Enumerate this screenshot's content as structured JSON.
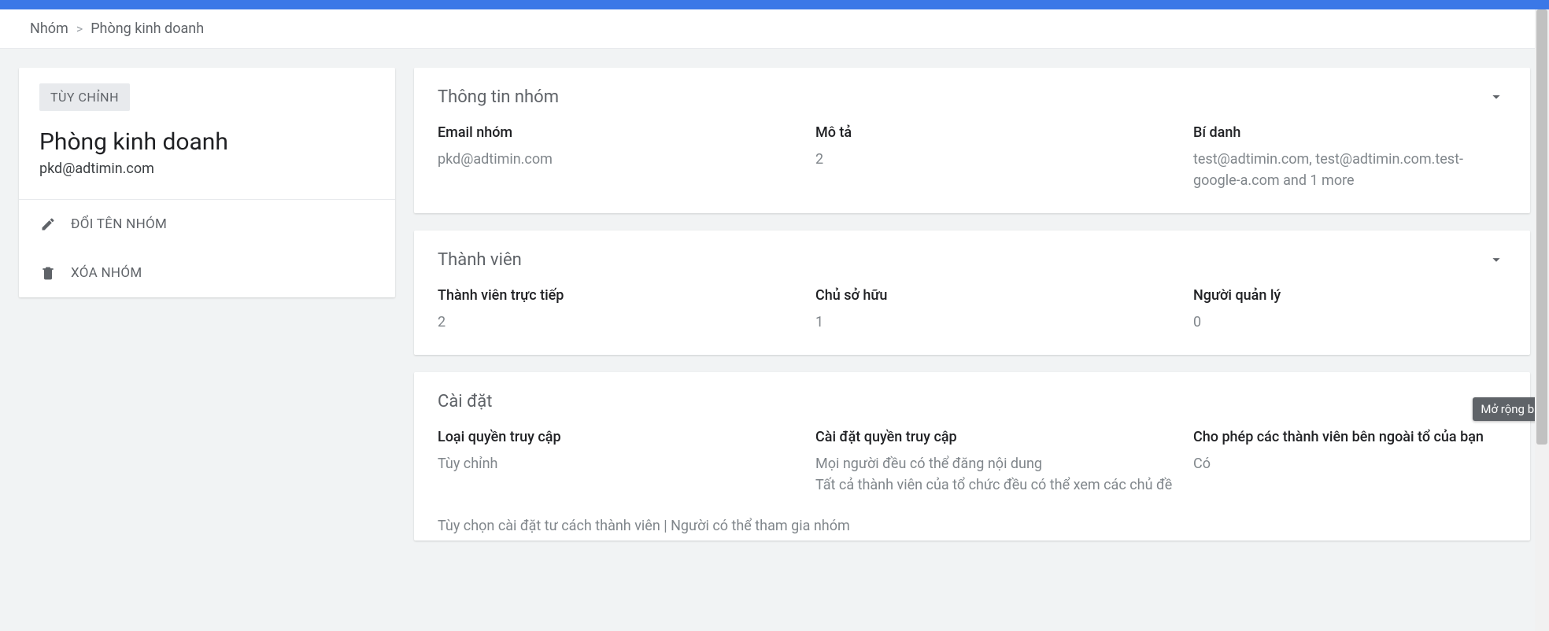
{
  "breadcrumb": {
    "root": "Nhóm",
    "sep": ">",
    "current": "Phòng kinh doanh"
  },
  "sidebar": {
    "badge": "TÙY CHỈNH",
    "title": "Phòng kinh doanh",
    "email": "pkd@adtimin.com",
    "actions": {
      "rename": "ĐỔI TÊN NHÓM",
      "delete": "XÓA NHÓM"
    }
  },
  "panels": {
    "info": {
      "title": "Thông tin nhóm",
      "fields": {
        "email_label": "Email nhóm",
        "email_value": "pkd@adtimin.com",
        "desc_label": "Mô tả",
        "desc_value": "2",
        "alias_label": "Bí danh",
        "alias_value": "test@adtimin.com, test@adtimin.com.test-google-a.com and 1 more"
      }
    },
    "members": {
      "title": "Thành viên",
      "fields": {
        "direct_label": "Thành viên trực tiếp",
        "direct_value": "2",
        "owner_label": "Chủ sở hữu",
        "owner_value": "1",
        "manager_label": "Người quản lý",
        "manager_value": "0"
      }
    },
    "settings": {
      "title": "Cài đặt",
      "fields": {
        "access_type_label": "Loại quyền truy cập",
        "access_type_value": "Tùy chỉnh",
        "access_settings_label": "Cài đặt quyền truy cập",
        "access_settings_value": "Mọi người đều có thể đăng nội dung\nTất cả thành viên của tổ chức đều có thể xem các chủ đề",
        "external_label": "Cho phép các thành viên bên ngoài tổ của bạn",
        "external_value": "Có"
      },
      "footer": "Tùy chọn cài đặt tư cách thành viên | Người có thể tham gia nhóm",
      "tooltip": "Mở rộng bảng"
    }
  }
}
